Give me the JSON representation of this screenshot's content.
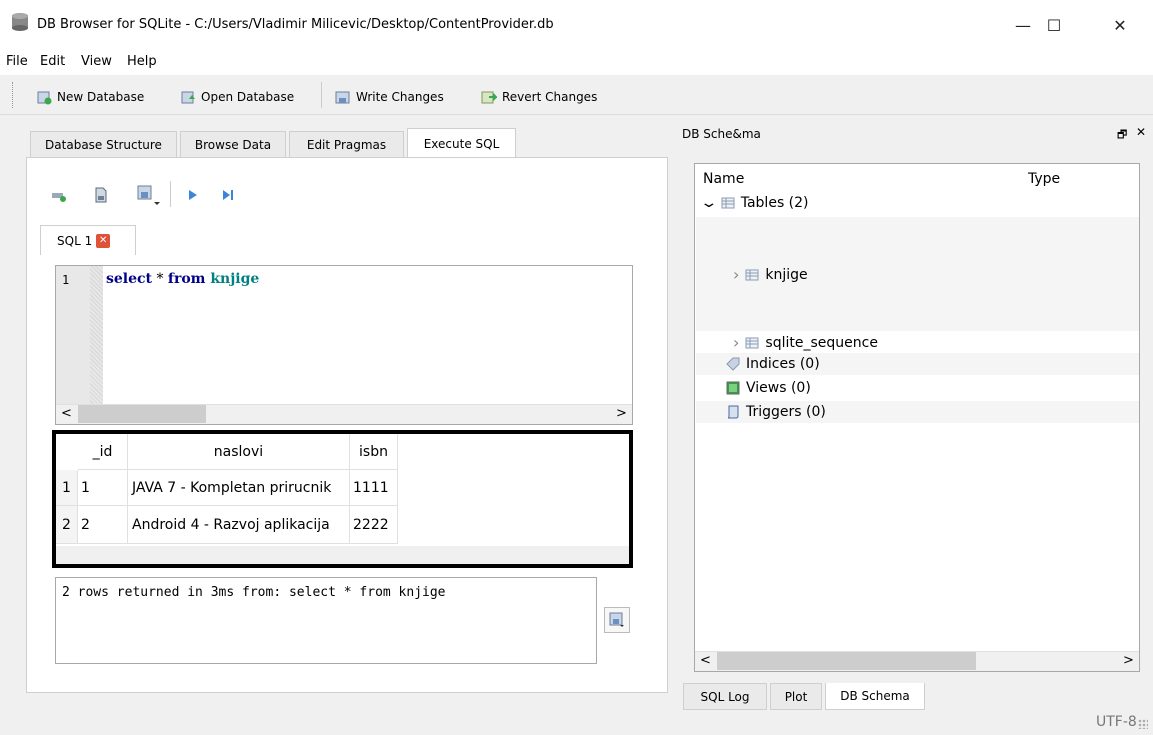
{
  "window": {
    "title": "DB Browser for SQLite - C:/Users/Vladimir Milicevic/Desktop/ContentProvider.db",
    "minimize": "—",
    "maximize": "☐",
    "close": "✕"
  },
  "menu": [
    "File",
    "Edit",
    "View",
    "Help"
  ],
  "toolbar": {
    "new_db": "New Database",
    "open_db": "Open Database",
    "write": "Write Changes",
    "revert": "Revert Changes"
  },
  "tabs": [
    "Database Structure",
    "Browse Data",
    "Edit Pragmas",
    "Execute SQL"
  ],
  "sql_tab": {
    "label": "SQL 1",
    "close": "✕"
  },
  "editor": {
    "line_number": "1",
    "kw1": "select",
    "op": " * ",
    "kw2": "from",
    "tbl": " knjige",
    "scroll_left": "<",
    "scroll_right": ">"
  },
  "results": {
    "headers": [
      "_id",
      "naslovi",
      "isbn"
    ],
    "rows": [
      {
        "num": "1",
        "id": "1",
        "naslov": "JAVA 7 - Kompletan prirucnik",
        "isbn": "1111"
      },
      {
        "num": "2",
        "id": "2",
        "naslov": "Android 4 - Razvoj aplikacija",
        "isbn": "2222"
      }
    ]
  },
  "message": "2 rows returned in 3ms from: select * from knjige",
  "dock": {
    "title": "DB Sche&ma",
    "float": "🗗",
    "close": "✕"
  },
  "schema": {
    "col_name": "Name",
    "col_type": "Type",
    "tables": "Tables (2)",
    "t1": "knjige",
    "t2": "sqlite_sequence",
    "indices": "Indices (0)",
    "views": "Views (0)",
    "triggers": "Triggers (0)",
    "expanded": "⌄",
    "collapsed": "›",
    "scroll_left": "<",
    "scroll_right": ">"
  },
  "bottom_tabs": [
    "SQL Log",
    "Plot",
    "DB Schema"
  ],
  "status": {
    "encoding": "UTF-8"
  },
  "colors": {
    "keyword": "#00008b",
    "table": "#008080",
    "close_badge": "#e0513a"
  }
}
